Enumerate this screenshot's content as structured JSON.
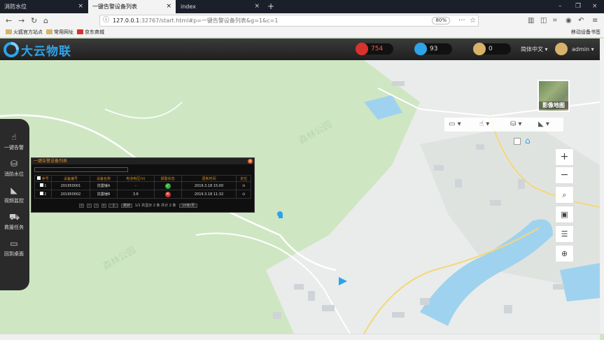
{
  "browser": {
    "tabs": [
      {
        "label": "消防水位",
        "close": "×"
      },
      {
        "label": "一键告警设备列表",
        "close": "×"
      },
      {
        "label": "index",
        "close": "×"
      }
    ],
    "new_tab": "+",
    "window_controls": [
      "–",
      "❐",
      "×"
    ],
    "url_host": "127.0.0.1",
    "url_rest": ":32767/start.html#p=一键告警设备列表&g=1&c=1",
    "zoom": "80%",
    "bookmarks": [
      "火狐官方站点",
      "常用网址",
      "京东商城"
    ],
    "bookmarks_mobile": "移动设备书签"
  },
  "app": {
    "logo": "大云物联",
    "alarm_count": "754",
    "user_count": "93",
    "msg_count": "0",
    "language": "简体中文 ▾",
    "username": "admin ▾",
    "colors": {
      "alarm": "#d8322d",
      "user": "#2ea3e8",
      "msg": "#d8b26a"
    }
  },
  "sidebar": [
    {
      "label": "一键告警",
      "icon": "hand-icon"
    },
    {
      "label": "消防水位",
      "icon": "water-level-icon"
    },
    {
      "label": "视频监控",
      "icon": "camera-icon"
    },
    {
      "label": "救援任务",
      "icon": "vehicle-icon"
    },
    {
      "label": "回到桌面",
      "icon": "desktop-icon"
    }
  ],
  "map": {
    "layer_label": "影像地图",
    "zoom_in": "+",
    "zoom_out": "−"
  },
  "panel": {
    "title": "一键告警设备列表",
    "close": "×",
    "columns": [
      "序号",
      "设备编号",
      "设备名称",
      "电池电压(V)",
      "报警状态",
      "更新时间",
      "定位"
    ],
    "rows": [
      {
        "index": "1",
        "code": "201950001",
        "name": "抗震锤A",
        "voltage": "-",
        "status": "ok",
        "time": "2019.3.18 15:00"
      },
      {
        "index": "2",
        "code": "201950002",
        "name": "抗震锤B",
        "voltage": "3.6",
        "status": "alarm",
        "time": "2019.3.18 11:32"
      }
    ],
    "pager": {
      "page": "1",
      "go": "跳转",
      "summary": "1/1  共显示 2  条  共计 2  条",
      "per_page": "10条/页"
    }
  }
}
